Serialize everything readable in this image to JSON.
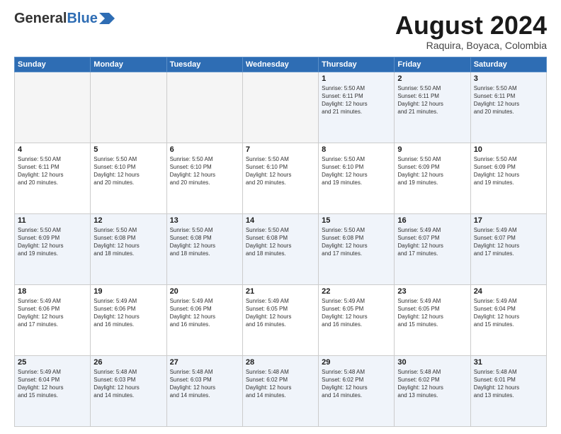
{
  "header": {
    "logo_general": "General",
    "logo_blue": "Blue",
    "month": "August 2024",
    "location": "Raquira, Boyaca, Colombia"
  },
  "weekdays": [
    "Sunday",
    "Monday",
    "Tuesday",
    "Wednesday",
    "Thursday",
    "Friday",
    "Saturday"
  ],
  "weeks": [
    [
      {
        "day": "",
        "info": "",
        "empty": true
      },
      {
        "day": "",
        "info": "",
        "empty": true
      },
      {
        "day": "",
        "info": "",
        "empty": true
      },
      {
        "day": "",
        "info": "",
        "empty": true
      },
      {
        "day": "1",
        "info": "Sunrise: 5:50 AM\nSunset: 6:11 PM\nDaylight: 12 hours\nand 21 minutes.",
        "empty": false
      },
      {
        "day": "2",
        "info": "Sunrise: 5:50 AM\nSunset: 6:11 PM\nDaylight: 12 hours\nand 21 minutes.",
        "empty": false
      },
      {
        "day": "3",
        "info": "Sunrise: 5:50 AM\nSunset: 6:11 PM\nDaylight: 12 hours\nand 20 minutes.",
        "empty": false
      }
    ],
    [
      {
        "day": "4",
        "info": "Sunrise: 5:50 AM\nSunset: 6:11 PM\nDaylight: 12 hours\nand 20 minutes.",
        "empty": false
      },
      {
        "day": "5",
        "info": "Sunrise: 5:50 AM\nSunset: 6:10 PM\nDaylight: 12 hours\nand 20 minutes.",
        "empty": false
      },
      {
        "day": "6",
        "info": "Sunrise: 5:50 AM\nSunset: 6:10 PM\nDaylight: 12 hours\nand 20 minutes.",
        "empty": false
      },
      {
        "day": "7",
        "info": "Sunrise: 5:50 AM\nSunset: 6:10 PM\nDaylight: 12 hours\nand 20 minutes.",
        "empty": false
      },
      {
        "day": "8",
        "info": "Sunrise: 5:50 AM\nSunset: 6:10 PM\nDaylight: 12 hours\nand 19 minutes.",
        "empty": false
      },
      {
        "day": "9",
        "info": "Sunrise: 5:50 AM\nSunset: 6:09 PM\nDaylight: 12 hours\nand 19 minutes.",
        "empty": false
      },
      {
        "day": "10",
        "info": "Sunrise: 5:50 AM\nSunset: 6:09 PM\nDaylight: 12 hours\nand 19 minutes.",
        "empty": false
      }
    ],
    [
      {
        "day": "11",
        "info": "Sunrise: 5:50 AM\nSunset: 6:09 PM\nDaylight: 12 hours\nand 19 minutes.",
        "empty": false
      },
      {
        "day": "12",
        "info": "Sunrise: 5:50 AM\nSunset: 6:08 PM\nDaylight: 12 hours\nand 18 minutes.",
        "empty": false
      },
      {
        "day": "13",
        "info": "Sunrise: 5:50 AM\nSunset: 6:08 PM\nDaylight: 12 hours\nand 18 minutes.",
        "empty": false
      },
      {
        "day": "14",
        "info": "Sunrise: 5:50 AM\nSunset: 6:08 PM\nDaylight: 12 hours\nand 18 minutes.",
        "empty": false
      },
      {
        "day": "15",
        "info": "Sunrise: 5:50 AM\nSunset: 6:08 PM\nDaylight: 12 hours\nand 17 minutes.",
        "empty": false
      },
      {
        "day": "16",
        "info": "Sunrise: 5:49 AM\nSunset: 6:07 PM\nDaylight: 12 hours\nand 17 minutes.",
        "empty": false
      },
      {
        "day": "17",
        "info": "Sunrise: 5:49 AM\nSunset: 6:07 PM\nDaylight: 12 hours\nand 17 minutes.",
        "empty": false
      }
    ],
    [
      {
        "day": "18",
        "info": "Sunrise: 5:49 AM\nSunset: 6:06 PM\nDaylight: 12 hours\nand 17 minutes.",
        "empty": false
      },
      {
        "day": "19",
        "info": "Sunrise: 5:49 AM\nSunset: 6:06 PM\nDaylight: 12 hours\nand 16 minutes.",
        "empty": false
      },
      {
        "day": "20",
        "info": "Sunrise: 5:49 AM\nSunset: 6:06 PM\nDaylight: 12 hours\nand 16 minutes.",
        "empty": false
      },
      {
        "day": "21",
        "info": "Sunrise: 5:49 AM\nSunset: 6:05 PM\nDaylight: 12 hours\nand 16 minutes.",
        "empty": false
      },
      {
        "day": "22",
        "info": "Sunrise: 5:49 AM\nSunset: 6:05 PM\nDaylight: 12 hours\nand 16 minutes.",
        "empty": false
      },
      {
        "day": "23",
        "info": "Sunrise: 5:49 AM\nSunset: 6:05 PM\nDaylight: 12 hours\nand 15 minutes.",
        "empty": false
      },
      {
        "day": "24",
        "info": "Sunrise: 5:49 AM\nSunset: 6:04 PM\nDaylight: 12 hours\nand 15 minutes.",
        "empty": false
      }
    ],
    [
      {
        "day": "25",
        "info": "Sunrise: 5:49 AM\nSunset: 6:04 PM\nDaylight: 12 hours\nand 15 minutes.",
        "empty": false
      },
      {
        "day": "26",
        "info": "Sunrise: 5:48 AM\nSunset: 6:03 PM\nDaylight: 12 hours\nand 14 minutes.",
        "empty": false
      },
      {
        "day": "27",
        "info": "Sunrise: 5:48 AM\nSunset: 6:03 PM\nDaylight: 12 hours\nand 14 minutes.",
        "empty": false
      },
      {
        "day": "28",
        "info": "Sunrise: 5:48 AM\nSunset: 6:02 PM\nDaylight: 12 hours\nand 14 minutes.",
        "empty": false
      },
      {
        "day": "29",
        "info": "Sunrise: 5:48 AM\nSunset: 6:02 PM\nDaylight: 12 hours\nand 14 minutes.",
        "empty": false
      },
      {
        "day": "30",
        "info": "Sunrise: 5:48 AM\nSunset: 6:02 PM\nDaylight: 12 hours\nand 13 minutes.",
        "empty": false
      },
      {
        "day": "31",
        "info": "Sunrise: 5:48 AM\nSunset: 6:01 PM\nDaylight: 12 hours\nand 13 minutes.",
        "empty": false
      }
    ]
  ]
}
